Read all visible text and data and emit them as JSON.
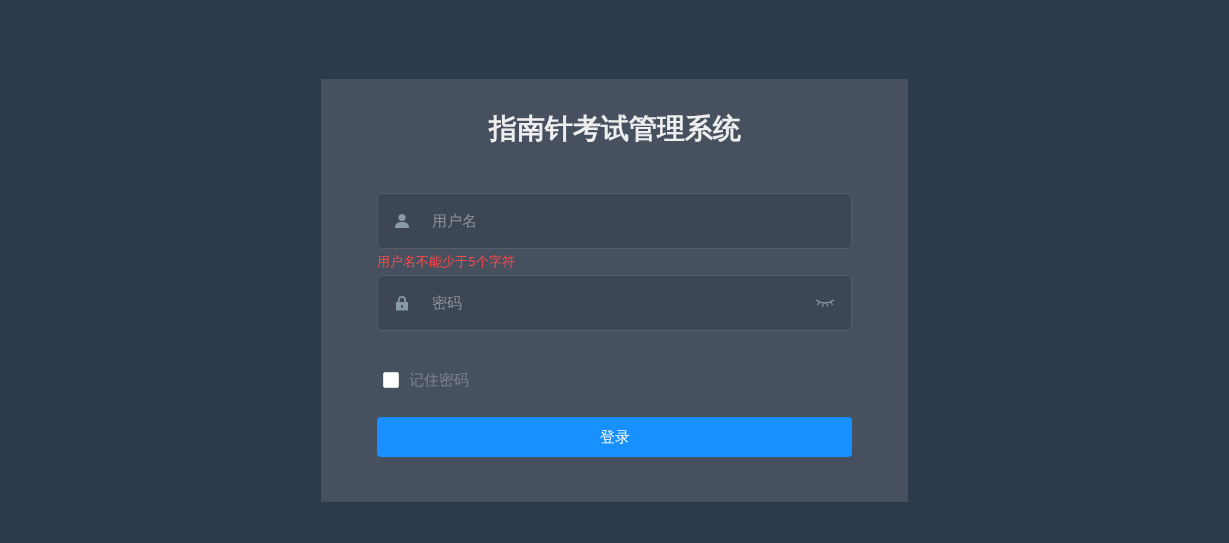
{
  "title": "指南针考试管理系统",
  "fields": [
    {
      "kind": "username",
      "placeholder": "用户名",
      "error": "用户名不能少于5个字符"
    },
    {
      "kind": "password",
      "placeholder": "密码"
    }
  ],
  "remember": {
    "label": "记住密码",
    "checked": false
  },
  "login_button": "登录"
}
